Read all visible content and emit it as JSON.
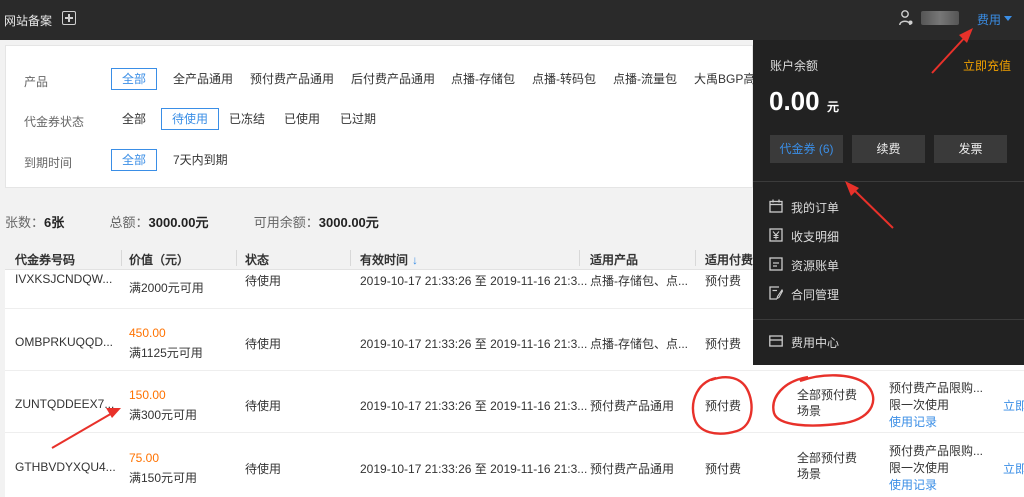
{
  "topbar": {
    "site_label": "网站备案",
    "add_icon": "plus-square-icon",
    "user_icon": "user-icon",
    "fee_label": "费用"
  },
  "filters": {
    "product": {
      "label": "产品",
      "options": [
        "全部",
        "全产品通用",
        "预付费产品通用",
        "后付费产品通用",
        "点播-存储包",
        "点播-转码包",
        "点播-流量包",
        "大禹BGP高"
      ]
    },
    "status": {
      "label": "代金券状态",
      "options": [
        "全部",
        "待使用",
        "已冻结",
        "已使用",
        "已过期"
      ]
    },
    "expiry": {
      "label": "到期时间",
      "options": [
        "全部",
        "7天内到期"
      ]
    }
  },
  "summary": {
    "count_label": "张数：",
    "count_value": "6张",
    "total_label": "总额：",
    "total_value": "3000.00元",
    "avail_label": "可用余额：",
    "avail_value": "3000.00元"
  },
  "table": {
    "headers": [
      "代金券号码",
      "价值（元）",
      "状态",
      "有效时间",
      "适用产品",
      "适用付费"
    ],
    "sort_icon": "arrow-down-icon",
    "rows": [
      {
        "code": "IVXKSJCNDQW...",
        "value": "",
        "condition": "满2000元可用",
        "status": "待使用",
        "time": "2019-10-17 21:33:26 至 2019-11-16 21:3...",
        "product": "点播-存储包、点...",
        "billing": "预付费",
        "scene": "",
        "limit": "",
        "limit2": "",
        "record": "",
        "action": ""
      },
      {
        "code": "OMBPRKUQQD...",
        "value": "450.00",
        "condition": "满1125元可用",
        "status": "待使用",
        "time": "2019-10-17 21:33:26 至 2019-11-16 21:3...",
        "product": "点播-存储包、点...",
        "billing": "预付费",
        "scene": "",
        "limit": "",
        "limit2": "",
        "record": "",
        "action": ""
      },
      {
        "code": "ZUNTQDDEEX7...",
        "value": "150.00",
        "condition": "满300元可用",
        "status": "待使用",
        "time": "2019-10-17 21:33:26 至 2019-11-16 21:3...",
        "product": "预付费产品通用",
        "billing": "预付费",
        "scene": "全部预付费场景",
        "limit": "预付费产品限购...",
        "limit2": "限一次使用",
        "record": "使用记录",
        "action": "立即"
      },
      {
        "code": "GTHBVDYXQU4...",
        "value": "75.00",
        "condition": "满150元可用",
        "status": "待使用",
        "time": "2019-10-17 21:33:26 至 2019-11-16 21:3...",
        "product": "预付费产品通用",
        "billing": "预付费",
        "scene": "全部预付费场景",
        "limit": "预付费产品限购...",
        "limit2": "限一次使用",
        "record": "使用记录",
        "action": "立即"
      }
    ]
  },
  "dropdown": {
    "balance_label": "账户余额",
    "recharge_label": "立即充值",
    "balance_value": "0.00",
    "balance_unit": "元",
    "buttons": [
      "代金券 (6)",
      "续费",
      "发票"
    ],
    "menu": [
      {
        "icon": "calendar-icon",
        "label": "我的订单"
      },
      {
        "icon": "yen-icon",
        "label": "收支明细"
      },
      {
        "icon": "document-icon",
        "label": "资源账单"
      },
      {
        "icon": "contract-icon",
        "label": "合同管理"
      }
    ],
    "center": {
      "icon": "card-icon",
      "label": "费用中心"
    }
  },
  "colors": {
    "accent": "#3a8ee6",
    "orange": "#ff7200",
    "annotation": "#e8312a"
  }
}
